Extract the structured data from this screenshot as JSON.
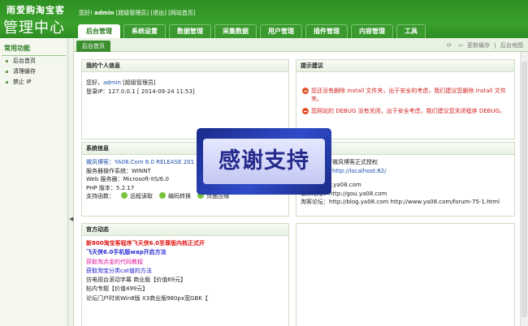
{
  "brand": {
    "top": "雨爱购淘宝客",
    "main": "管理中心"
  },
  "userbar": {
    "hello": "您好!",
    "user": "admin",
    "role": "[超级管理员]",
    "logout": "[退出]",
    "site": "[网站首页]"
  },
  "nav": [
    "后台管理",
    "系统设置",
    "数据管理",
    "采集数据",
    "用户管理",
    "插件管理",
    "内容管理",
    "工具"
  ],
  "sidebar": {
    "title": "常用功能",
    "items": [
      "后台首页",
      "清理缓存",
      "禁止 IP"
    ]
  },
  "breadcrumb": "后台首页",
  "tools": {
    "refresh_cache": "更新缓存",
    "map": "后台地图"
  },
  "panels": {
    "info": {
      "title": "我的个人信息",
      "hello": "您好，",
      "user": "admin",
      "role": "[超级管理员]",
      "login": "登录IP：127.0.0.1 [ 2014-09-24 11:53]"
    },
    "tips": {
      "title": "提示建议",
      "tip1": "您还没有删除 install 文件夹，出于安全的考虑，我们建议您删除 install 文件夹。",
      "tip2": "您网站的 DEBUG 没有关闭，出于安全考虑，我们建议您关闭程序 DEBUG。"
    },
    "sys": {
      "title": "系统信息",
      "blog": "微风博客：YA08.Com 6.0 RELEASE 201",
      "os": "服务器操作系统：WINNT",
      "web": "Web 服务器：Microsoft-IIS/6.0",
      "php": "PHP 版本：5.2.17",
      "support": "支持函数：",
      "f1": "远程读取",
      "f2": "编码转换",
      "f3": "页面压缩"
    },
    "right": {
      "auth": "微风博客正式授权",
      "url": "http://localhost:82/",
      "site": "http://www.ya08.com",
      "demo": "演示地址：http://gou.ya08.com",
      "forum": "淘客论坛：http://blog.ya08.com http://www.ya08.com/forum-75-1.html"
    },
    "news": {
      "title": "官方动态",
      "items": [
        "新800淘宝客程序飞天侠6.0至尊版内核正式开",
        "飞天侠6.0手机版wap开启方法",
        "获取淘点金的代码教程",
        "获取淘宝分类cat值的方法",
        "仿电视台滚动字幕 商业版【价值69元】",
        "帖内专题【价值499元】",
        "论坛门户时尚Win8版 X3商业版980px宽GBK【"
      ]
    }
  },
  "overlay": "感谢支持"
}
